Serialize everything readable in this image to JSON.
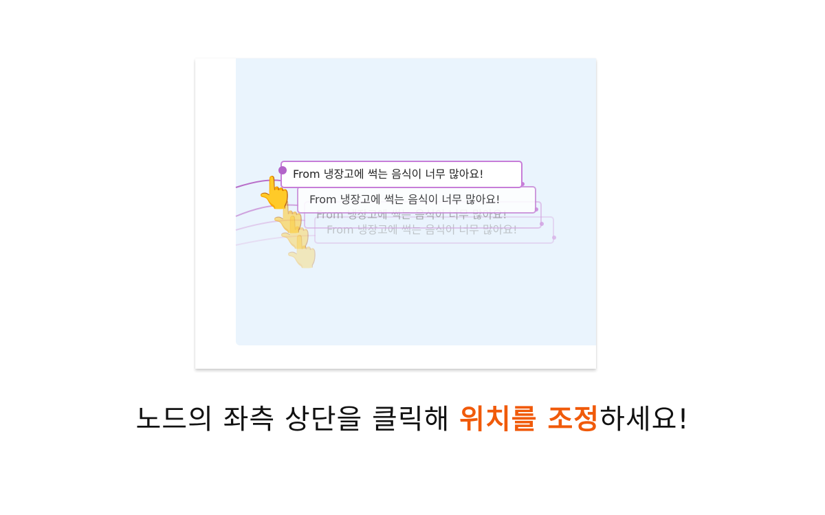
{
  "node_label": "From 냉장고에 썩는 음식이 너무 많아요!",
  "caption": {
    "before": "노드의 좌측 상단을 클릭해 ",
    "highlight": "위치를 조정",
    "after": "하세요!"
  },
  "colors": {
    "accent": "#f05a0a",
    "node_border": "#c77dd8",
    "canvas_bg": "#eaf4fd"
  },
  "icons": [
    "pointing-hand-icon"
  ]
}
